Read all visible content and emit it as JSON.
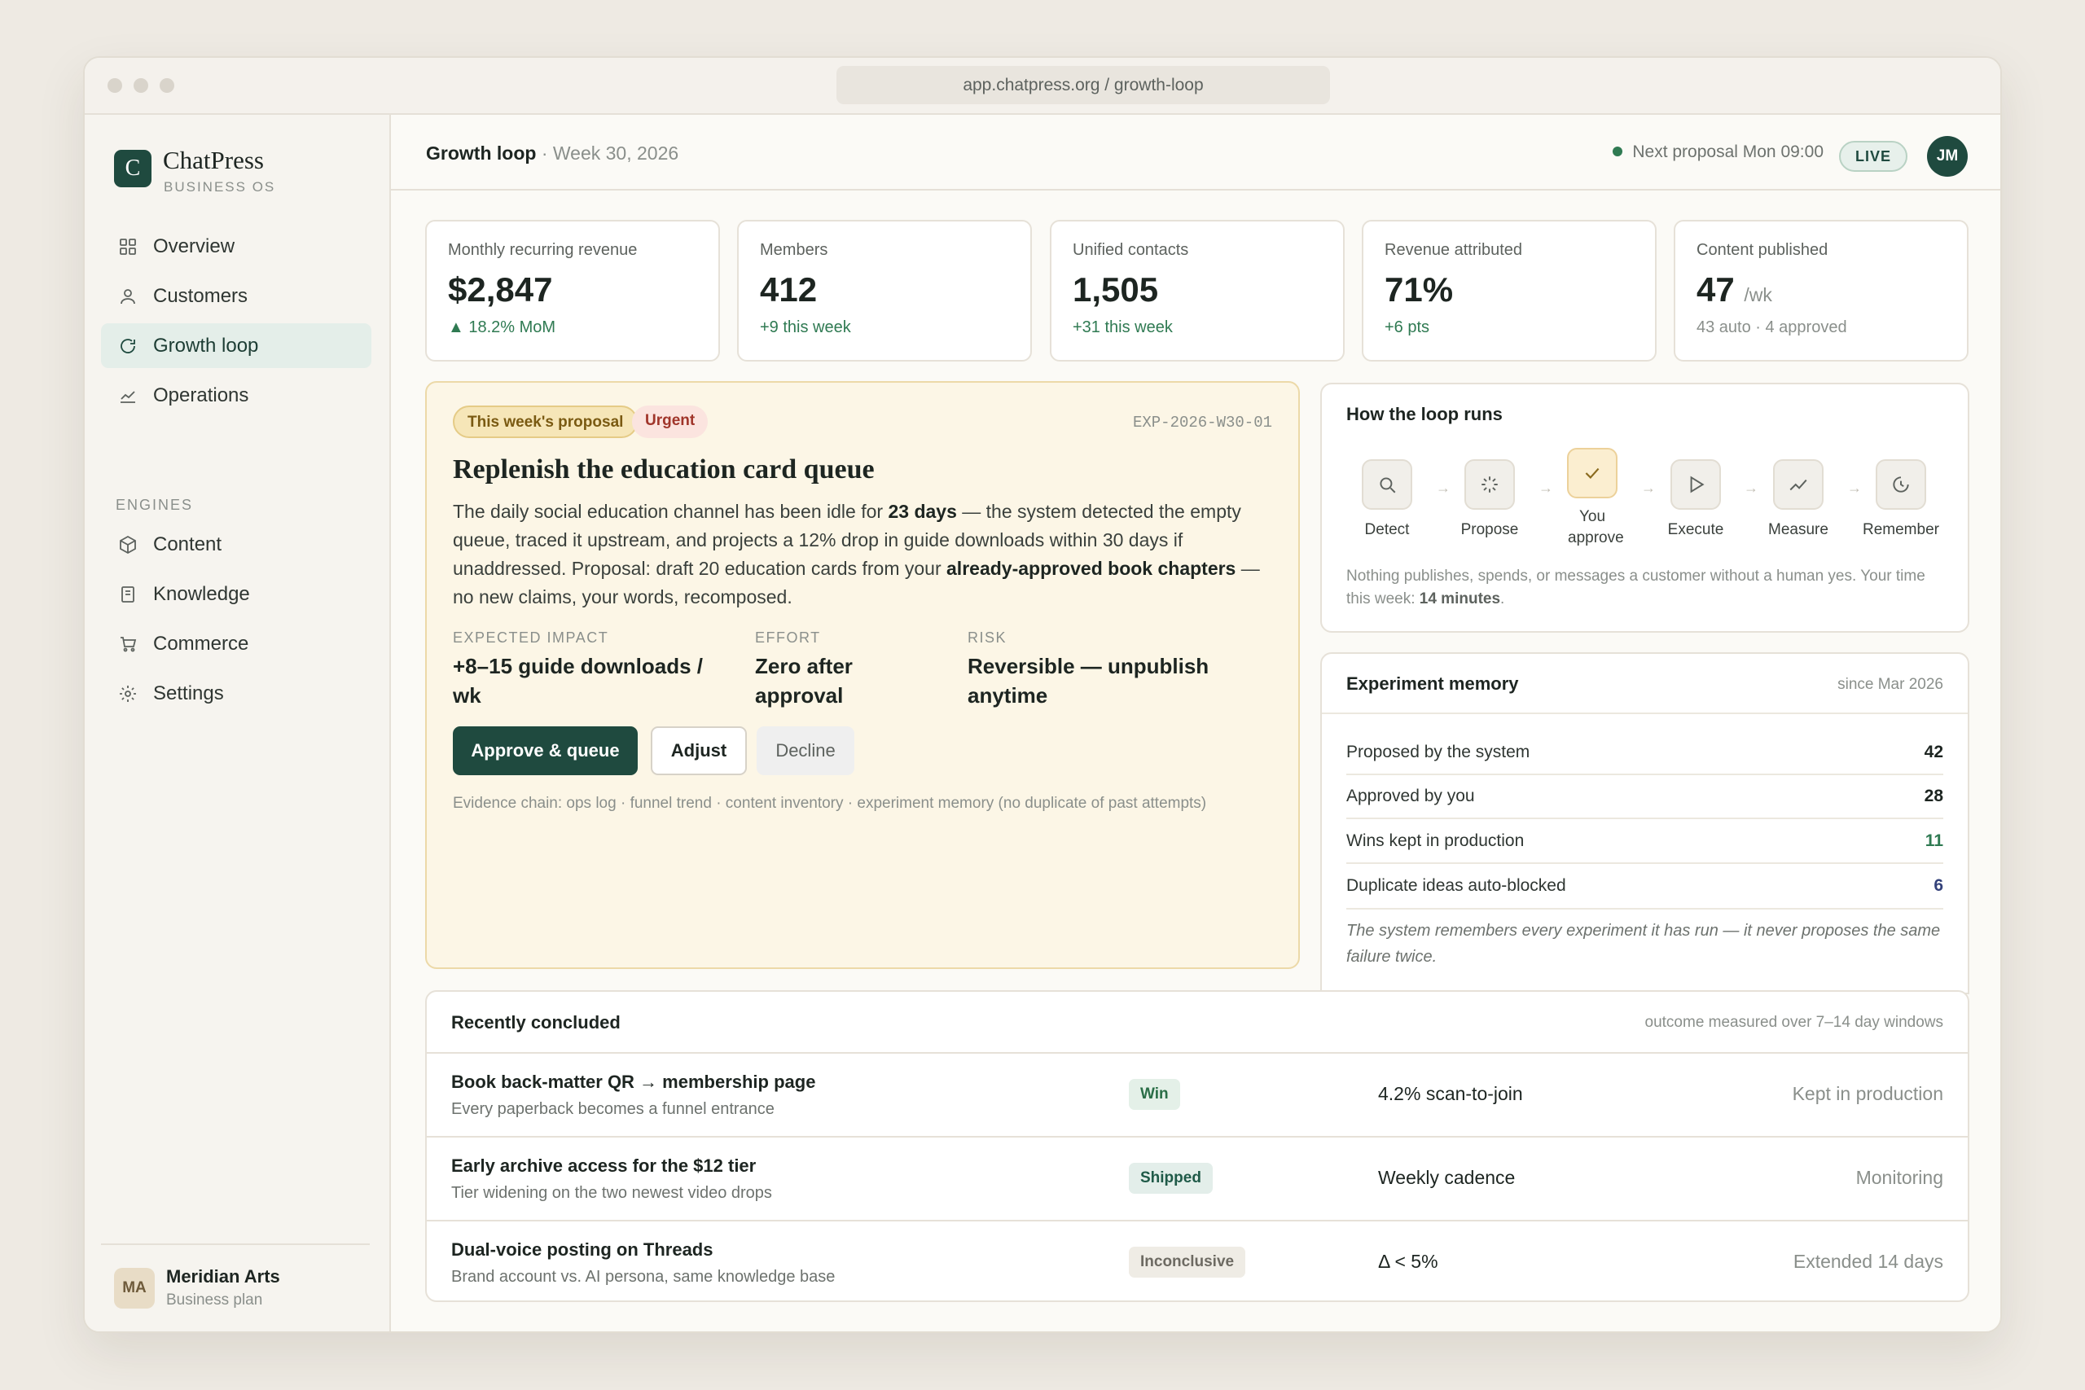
{
  "browser": {
    "url": "app.chatpress.org / growth-loop"
  },
  "sidebar": {
    "logo_letter": "C",
    "brand": "ChatPress",
    "brand_sub": "BUSINESS OS",
    "items": [
      {
        "label": "Overview",
        "icon": "grid-icon"
      },
      {
        "label": "Customers",
        "icon": "user-icon"
      },
      {
        "label": "Growth loop",
        "icon": "refresh-icon",
        "active": true
      },
      {
        "label": "Operations",
        "icon": "trend-icon"
      }
    ],
    "section": "ENGINES",
    "engines": [
      {
        "label": "Content",
        "icon": "cube-icon"
      },
      {
        "label": "Knowledge",
        "icon": "book-icon"
      },
      {
        "label": "Commerce",
        "icon": "cart-icon"
      },
      {
        "label": "Settings",
        "icon": "gear-icon"
      }
    ],
    "footer": {
      "initials": "MA",
      "name": "Meridian Arts",
      "plan": "Business plan"
    }
  },
  "header": {
    "title": "Growth loop",
    "separator": "·",
    "week": "Week 30, 2026",
    "next_proposal": "Next proposal Mon 09:00",
    "live": "LIVE",
    "user_initials": "JM"
  },
  "kpis": [
    {
      "label": "Monthly recurring revenue",
      "value": "$2,847",
      "unit": "",
      "delta": "▲ 18.2% MoM"
    },
    {
      "label": "Members",
      "value": "412",
      "unit": "",
      "delta": "+9 this week"
    },
    {
      "label": "Unified contacts",
      "value": "1,505",
      "unit": "",
      "delta": "+31 this week"
    },
    {
      "label": "Revenue attributed",
      "value": "71%",
      "unit": "",
      "delta": "+6 pts"
    },
    {
      "label": "Content published",
      "value": "47",
      "unit": "/wk",
      "delta": "43 auto · 4 approved"
    }
  ],
  "proposal": {
    "pill_week": "This week's proposal",
    "pill_urgent": "Urgent",
    "id": "EXP-2026-W30-01",
    "title": "Replenish the education card queue",
    "desc_1": "The daily social education channel has been idle for ",
    "desc_bold_1": "23 days",
    "desc_2": " — the system detected the empty queue, traced it upstream, and projects a 12% drop in guide downloads within 30 days if unaddressed. Proposal: draft 20 education cards from your ",
    "desc_bold_2": "already-approved book chapters",
    "desc_3": " — no new claims, your words, recomposed.",
    "impact_label": "EXPECTED IMPACT",
    "impact_value": "+8–15 guide downloads / wk",
    "effort_label": "EFFORT",
    "effort_value": "Zero after approval",
    "risk_label": "RISK",
    "risk_value": "Reversible — unpublish anytime",
    "approve": "Approve & queue",
    "adjust": "Adjust",
    "decline": "Decline",
    "evidence": "Evidence chain: ops log · funnel trend · content inventory · experiment memory (no duplicate of past attempts)"
  },
  "loop": {
    "title": "How the loop runs",
    "steps": [
      {
        "label": "Detect",
        "icon": "search-icon"
      },
      {
        "label": "Propose",
        "icon": "sparkle-icon"
      },
      {
        "label": "You approve",
        "icon": "check-icon"
      },
      {
        "label": "Execute",
        "icon": "play-icon"
      },
      {
        "label": "Measure",
        "icon": "trend-icon"
      },
      {
        "label": "Remember",
        "icon": "moon-icon"
      }
    ],
    "arrow": "→",
    "note_1": "Nothing publishes, spends, or messages a customer without a human yes. Your time this week: ",
    "note_bold": "14 minutes",
    "note_2": "."
  },
  "memory": {
    "title": "Experiment memory",
    "since": "since Mar 2026",
    "rows": [
      {
        "label": "Proposed by the system",
        "value": "42"
      },
      {
        "label": "Approved by you",
        "value": "28"
      },
      {
        "label": "Wins kept in production",
        "value": "11"
      },
      {
        "label": "Duplicate ideas auto-blocked",
        "value": "6"
      }
    ],
    "note": "The system remembers every experiment it has run — it never proposes the same failure twice."
  },
  "recent": {
    "title": "Recently concluded",
    "note": "outcome measured over 7–14 day windows",
    "rows": [
      {
        "title": "Book back-matter QR → membership page",
        "sub": "Every paperback becomes a funnel entrance",
        "badge": "Win",
        "metric": "4.2% scan-to-join",
        "status": "Kept in production"
      },
      {
        "title": "Early archive access for the $12 tier",
        "sub": "Tier widening on the two newest video drops",
        "badge": "Shipped",
        "metric": "Weekly cadence",
        "status": "Monitoring"
      },
      {
        "title": "Dual-voice posting on Threads",
        "sub": "Brand account vs. AI persona, same knowledge base",
        "badge": "Inconclusive",
        "metric": "Δ < 5%",
        "status": "Extended 14 days"
      }
    ]
  },
  "colors": {
    "brand": "#1f4a3f",
    "positive": "#2f7a52",
    "highlight": "#fcf6e6",
    "urgent": "#a0352a"
  }
}
